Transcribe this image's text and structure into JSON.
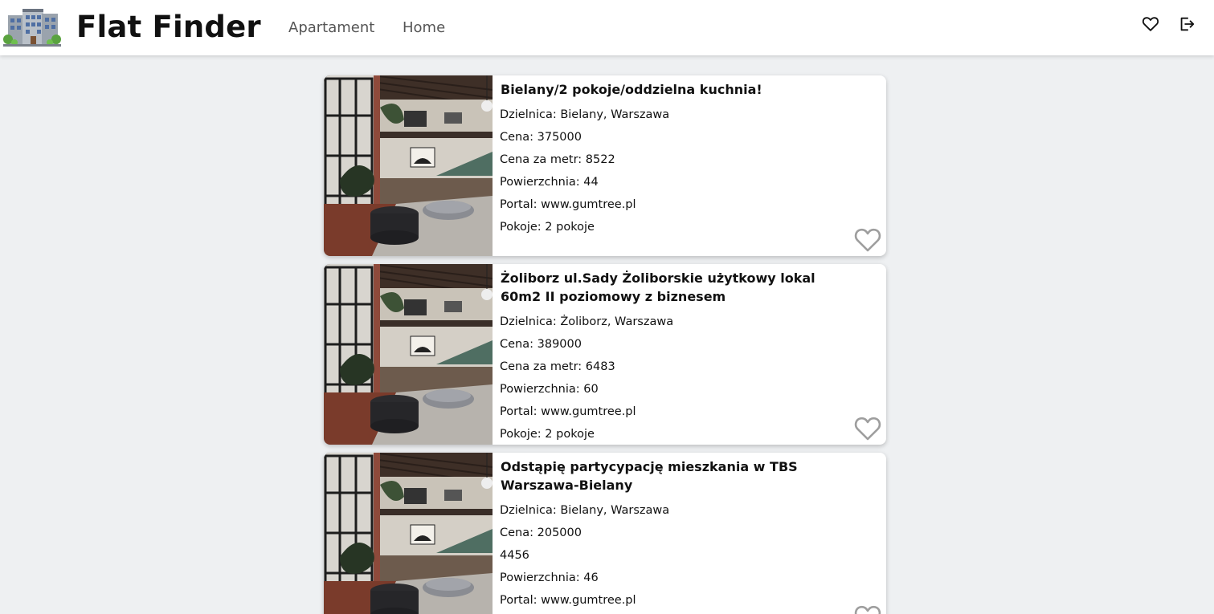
{
  "app": {
    "title": "Flat Finder"
  },
  "nav": {
    "links": [
      {
        "label": "Apartament"
      },
      {
        "label": "Home"
      }
    ],
    "icons": {
      "favorites": "heart-icon",
      "logout": "logout-icon"
    }
  },
  "listings": [
    {
      "title": "Bielany/2 pokoje/oddzielna kuchnia!",
      "district": "Dzielnica: Bielany, Warszawa",
      "price": "Cena: 375000",
      "price_per_m": "Cena za metr: 8522",
      "area": "Powierzchnia: 44",
      "portal": "Portal: www.gumtree.pl",
      "rooms": "Pokoje: 2 pokoje"
    },
    {
      "title": "Żoliborz ul.Sady Żoliborskie użytkowy lokal 60m2 II poziomowy z biznesem",
      "district": "Dzielnica: Żoliborz, Warszawa",
      "price": "Cena: 389000",
      "price_per_m": "Cena za metr: 6483",
      "area": "Powierzchnia: 60",
      "portal": "Portal: www.gumtree.pl",
      "rooms": "Pokoje: 2 pokoje"
    },
    {
      "title": "Odstąpię partycypację mieszkania w TBS Warszawa-Bielany",
      "district": "Dzielnica: Bielany, Warszawa",
      "price": "Cena: 205000",
      "price_per_m": "4456",
      "area": "Powierzchnia: 46",
      "portal": "Portal: www.gumtree.pl"
    }
  ],
  "colors": {
    "background": "#eef0f2",
    "card": "#ffffff",
    "heart_outline": "#9e9e9e",
    "nav_link": "#555555"
  }
}
